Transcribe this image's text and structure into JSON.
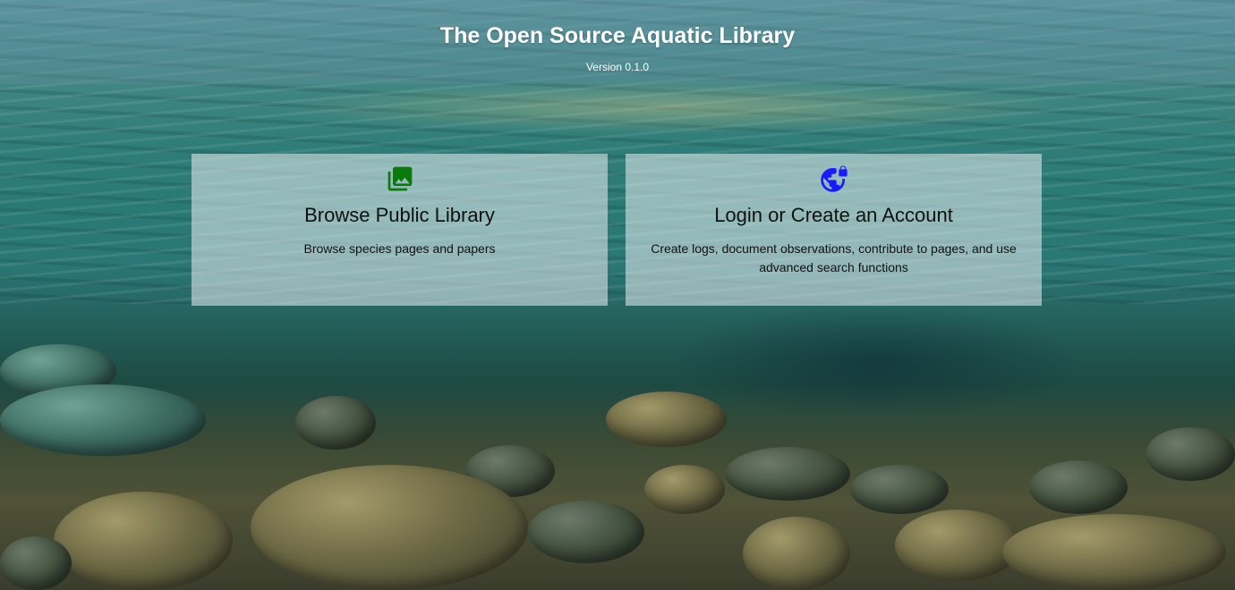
{
  "header": {
    "title": "The Open Source Aquatic Library",
    "version": "Version 0.1.0"
  },
  "cards": [
    {
      "icon": "photo-library-icon",
      "icon_color": "#0a7a0a",
      "title": "Browse Public Library",
      "description": "Browse species pages and papers"
    },
    {
      "icon": "public-globe-lock-icon",
      "icon_color": "#1a1aff",
      "title": "Login or Create an Account",
      "description": "Create logs, document observations, contribute to pages, and use advanced search functions"
    }
  ]
}
